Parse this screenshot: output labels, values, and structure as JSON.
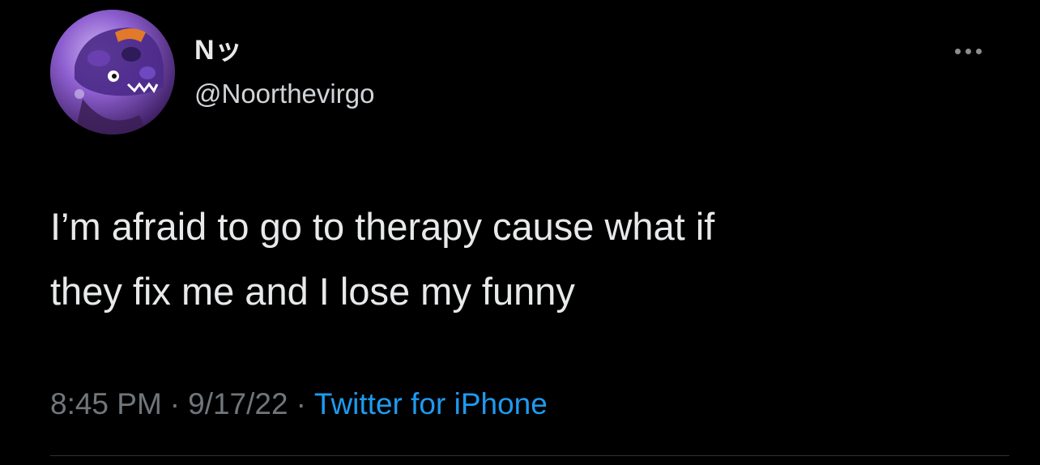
{
  "author": {
    "display_name": "Nッ",
    "handle": "@Noorthevirgo"
  },
  "tweet": {
    "text_lines": [
      "I’m afraid to go to therapy cause what if",
      "they fix me and I lose my funny"
    ]
  },
  "meta": {
    "time": "8:45 PM",
    "separator": "·",
    "date": "9/17/22",
    "source": "Twitter for iPhone"
  },
  "icons": {
    "more": "more-horizontal-icon",
    "avatar": "profile-avatar"
  },
  "colors": {
    "background": "#000000",
    "text_primary": "#e7e9ea",
    "text_secondary": "#71767b",
    "link": "#1d9bf0"
  }
}
